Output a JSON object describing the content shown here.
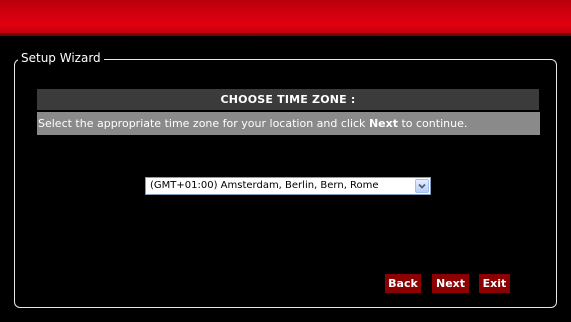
{
  "wizard": {
    "legend": "Setup Wizard",
    "header": "CHOOSE TIME ZONE :",
    "instruction": {
      "prefix": "Select the appropriate time zone for your location and click ",
      "emphasis": "Next",
      "suffix": " to continue."
    },
    "timezone": {
      "selected": "(GMT+01:00) Amsterdam, Berlin, Bern, Rome"
    },
    "buttons": {
      "back": "Back",
      "next": "Next",
      "exit": "Exit"
    }
  },
  "colors": {
    "top_bar": "#d60010",
    "header_bar": "#3b3b3b",
    "instruction_bar": "#8a8a8a",
    "button": "#8b0000",
    "background": "#000000"
  },
  "icons": {
    "dropdown": "chevron-down-icon"
  }
}
